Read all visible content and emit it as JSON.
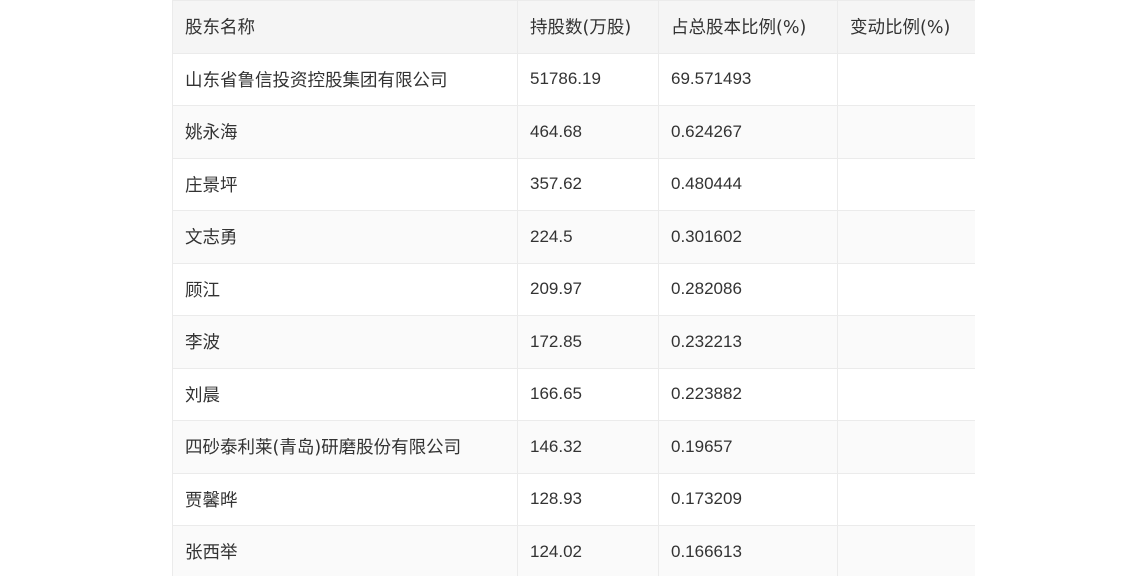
{
  "table": {
    "headers": [
      "股东名称",
      "持股数(万股)",
      "占总股本比例(%)",
      "变动比例(%)"
    ],
    "rows": [
      [
        "山东省鲁信投资控股集团有限公司",
        "51786.19",
        "69.571493",
        ""
      ],
      [
        "姚永海",
        "464.68",
        "0.624267",
        ""
      ],
      [
        "庄景坪",
        "357.62",
        "0.480444",
        ""
      ],
      [
        "文志勇",
        "224.5",
        "0.301602",
        ""
      ],
      [
        "顾江",
        "209.97",
        "0.282086",
        ""
      ],
      [
        "李波",
        "172.85",
        "0.232213",
        ""
      ],
      [
        "刘晨",
        "166.65",
        "0.223882",
        ""
      ],
      [
        "四砂泰利莱(青岛)研磨股份有限公司",
        "146.32",
        "0.19657",
        ""
      ],
      [
        "贾馨晔",
        "128.93",
        "0.173209",
        ""
      ],
      [
        "张西举",
        "124.02",
        "0.166613",
        ""
      ]
    ]
  }
}
